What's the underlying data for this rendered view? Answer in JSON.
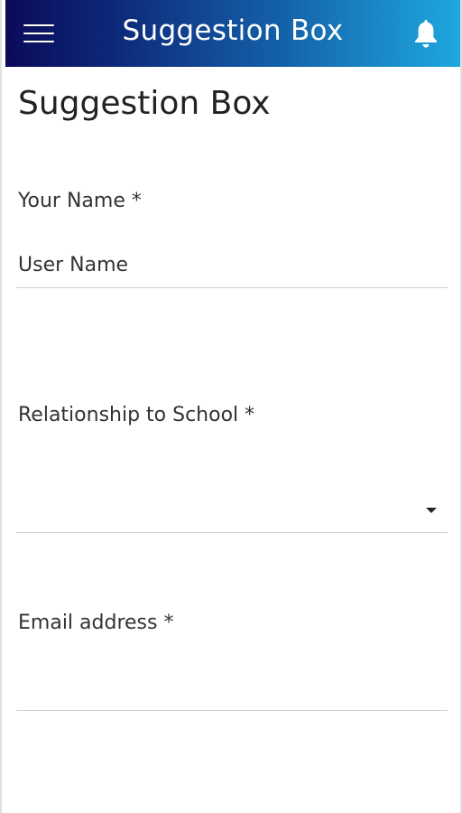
{
  "app_bar": {
    "title": "Suggestion Box",
    "menu_icon": "hamburger-menu-icon",
    "notification_icon": "bell-icon",
    "gradient_start": "#0b0a5a",
    "gradient_end": "#1ea8df"
  },
  "page": {
    "title": "Suggestion Box"
  },
  "form": {
    "name": {
      "label": "Your Name *",
      "value": "User Name"
    },
    "relationship": {
      "label": "Relationship to School *",
      "value": ""
    },
    "email": {
      "label": "Email address *",
      "value": ""
    }
  }
}
